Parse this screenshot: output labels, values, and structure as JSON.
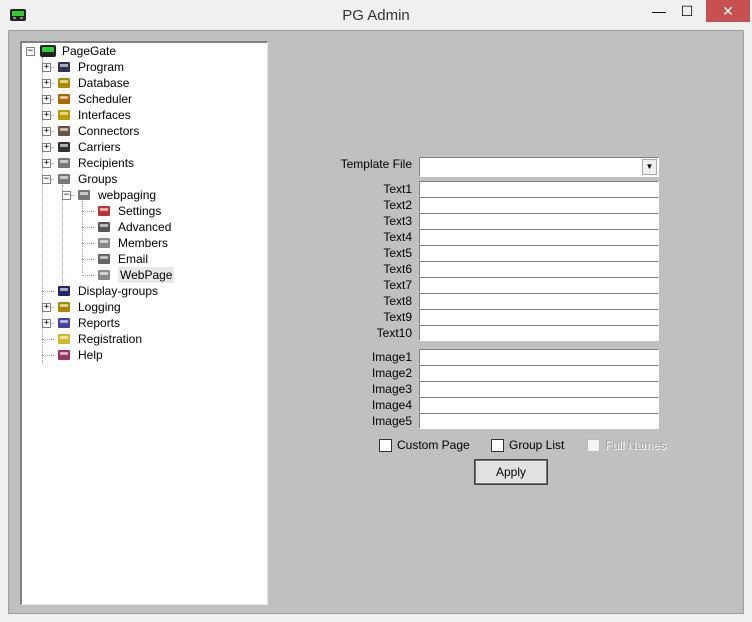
{
  "window": {
    "title": "PG Admin",
    "minimize_glyph": "—",
    "maximize_glyph": "☐",
    "close_glyph": "✕"
  },
  "tree": {
    "root": "PageGate",
    "items": [
      {
        "label": "Program",
        "icon": "program-icon"
      },
      {
        "label": "Database",
        "icon": "database-icon"
      },
      {
        "label": "Scheduler",
        "icon": "scheduler-icon"
      },
      {
        "label": "Interfaces",
        "icon": "interfaces-icon"
      },
      {
        "label": "Connectors",
        "icon": "connectors-icon"
      },
      {
        "label": "Carriers",
        "icon": "carriers-icon"
      },
      {
        "label": "Recipients",
        "icon": "recipients-icon"
      },
      {
        "label": "Groups",
        "icon": "groups-icon"
      },
      {
        "label": "webpaging",
        "icon": "group-icon"
      },
      {
        "label": "Settings",
        "icon": "settings-icon"
      },
      {
        "label": "Advanced",
        "icon": "advanced-icon"
      },
      {
        "label": "Members",
        "icon": "members-icon"
      },
      {
        "label": "Email",
        "icon": "email-icon"
      },
      {
        "label": "WebPage",
        "icon": "webpage-icon"
      },
      {
        "label": "Display-groups",
        "icon": "display-groups-icon"
      },
      {
        "label": "Logging",
        "icon": "logging-icon"
      },
      {
        "label": "Reports",
        "icon": "reports-icon"
      },
      {
        "label": "Registration",
        "icon": "registration-icon"
      },
      {
        "label": "Help",
        "icon": "help-icon"
      }
    ],
    "expand_plus": "+",
    "expand_minus": "−"
  },
  "form": {
    "template_file_label": "Template File",
    "template_file_value": "",
    "combo_arrow": "▼",
    "text_labels": [
      "Text1",
      "Text2",
      "Text3",
      "Text4",
      "Text5",
      "Text6",
      "Text7",
      "Text8",
      "Text9",
      "Text10"
    ],
    "text_values": [
      "",
      "",
      "",
      "",
      "",
      "",
      "",
      "",
      "",
      ""
    ],
    "image_labels": [
      "Image1",
      "Image2",
      "Image3",
      "Image4",
      "Image5"
    ],
    "image_values": [
      "",
      "",
      "",
      "",
      ""
    ],
    "custom_page_label": "Custom Page",
    "group_list_label": "Group List",
    "full_names_label": "Full Names",
    "custom_page_checked": false,
    "group_list_checked": false,
    "full_names_checked": false,
    "apply_label": "Apply"
  }
}
